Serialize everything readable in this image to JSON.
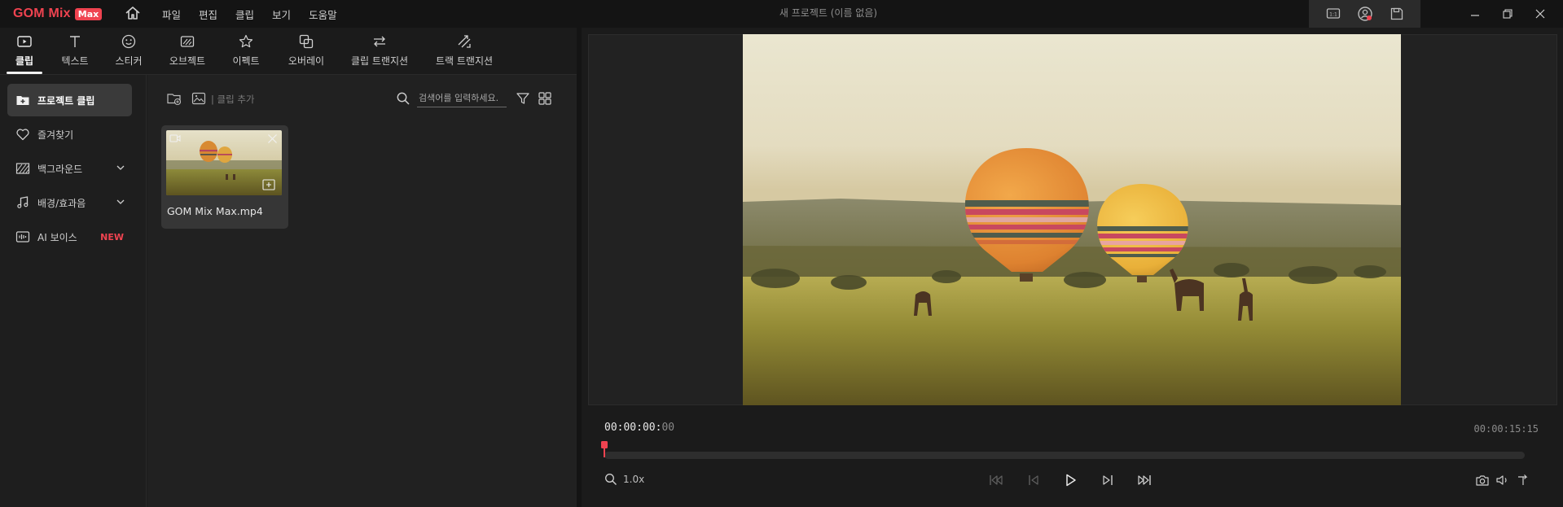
{
  "app": {
    "brand": "GOM Mix",
    "badge": "Max",
    "project_title": "새 프로젝트 (이름 없음)"
  },
  "menu": [
    "파일",
    "편집",
    "클립",
    "보기",
    "도움말"
  ],
  "tabs": [
    {
      "label": "클립",
      "icon": "clip-icon",
      "active": true
    },
    {
      "label": "텍스트",
      "icon": "text-icon"
    },
    {
      "label": "스티커",
      "icon": "sticker-icon"
    },
    {
      "label": "오브젝트",
      "icon": "object-icon"
    },
    {
      "label": "이펙트",
      "icon": "effect-icon"
    },
    {
      "label": "오버레이",
      "icon": "overlay-icon"
    },
    {
      "label": "클립 트랜지션",
      "icon": "clip-transition-icon"
    },
    {
      "label": "트랙 트랜지션",
      "icon": "track-transition-icon"
    }
  ],
  "sidebar": {
    "items": [
      {
        "label": "프로젝트 클립",
        "icon": "add-folder-icon",
        "active": true
      },
      {
        "label": "즐겨찾기",
        "icon": "heart-icon"
      },
      {
        "label": "백그라운드",
        "icon": "pattern-icon",
        "expandable": true
      },
      {
        "label": "배경/효과음",
        "icon": "music-icon",
        "expandable": true
      },
      {
        "label": "AI 보이스",
        "icon": "waveform-icon",
        "badge": "NEW"
      }
    ]
  },
  "clip_panel": {
    "add_clip_label": "| 클립 추가",
    "search_placeholder": "검색어를 입력하세요.",
    "clips": [
      {
        "name": "GOM Mix Max.mp4",
        "type": "video"
      }
    ]
  },
  "player": {
    "current_time_main": "00:00:00:",
    "current_time_frames": "00",
    "total_time": "00:00:15:15",
    "zoom": "1.0x",
    "progress": 0.0
  },
  "colors": {
    "brand": "#ef4350",
    "background": "#1b1b1b",
    "panel": "#212121"
  }
}
